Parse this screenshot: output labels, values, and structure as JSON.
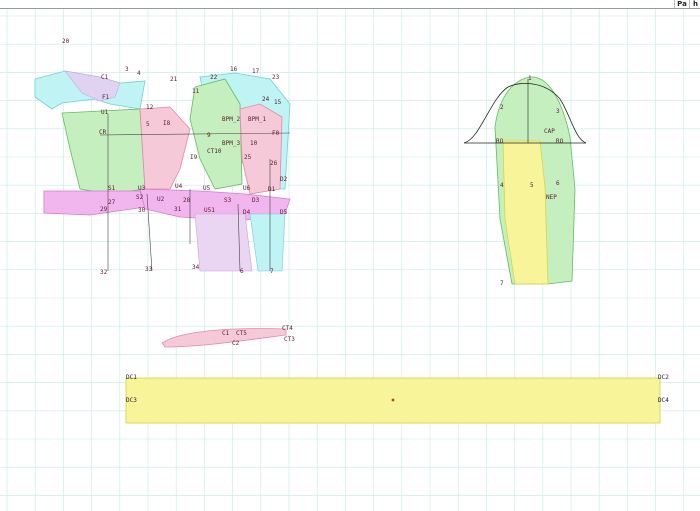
{
  "toolbar": {
    "btn1": "Pa",
    "btn2": "h"
  },
  "labels": {
    "l20": "20",
    "l3": "3",
    "l4": "4",
    "l9": "9",
    "l10": "10",
    "l11": "11",
    "l12": "12",
    "l15": "15",
    "l16": "16",
    "l17": "17",
    "l21": "21",
    "l22": "22",
    "l23": "23",
    "l24": "24",
    "l25": "25",
    "l26": "26",
    "l27": "27",
    "l28": "28",
    "l29": "29",
    "l30": "30",
    "l31": "31",
    "l32": "32",
    "l33": "33",
    "l34": "34",
    "l5": "5",
    "l6": "6",
    "l7": "7",
    "bpm2": "BPM_2",
    "bpm1": "BPM_1",
    "bpm3": "BPM_3",
    "f0": "F0",
    "c1": "C1",
    "cr": "CR",
    "ct10": "CT10",
    "u1": "U1",
    "u2": "U2",
    "u3": "U3",
    "u4": "U4",
    "u5": "U5",
    "u6": "U6",
    "u51": "U51",
    "i8": "I8",
    "i9": "I9",
    "s1": "S1",
    "s2": "S2",
    "s3": "S3",
    "f1": "F1",
    "d1": "D1",
    "d2": "D2",
    "d3": "D3",
    "d4": "D4",
    "d5": "D5",
    "sleeve_cap": "CAP",
    "sleeve_nep": "NEP",
    "ro1": "RO",
    "ro2": "RO",
    "sl1": "1",
    "sl2": "2",
    "sl3": "3",
    "sl4": "4",
    "sl5": "5",
    "sl6": "6",
    "sl7": "7",
    "cf1": "C1",
    "cf2": "C2",
    "cf3": "CT3",
    "cf4": "CT4",
    "cf5": "CT5",
    "dc1": "DC1",
    "dc2": "DC2",
    "dc3": "DC3",
    "dc4": "DC4"
  },
  "colors": {
    "grid": "#c9e7e7",
    "cyan": "#bff3f4",
    "green": "#c6efc0",
    "pink": "#f6c9d8",
    "lavender": "#e4d0f2",
    "magenta": "#f2b6ee",
    "yellow": "#f7f49a",
    "outline": "#6fd0d8"
  }
}
